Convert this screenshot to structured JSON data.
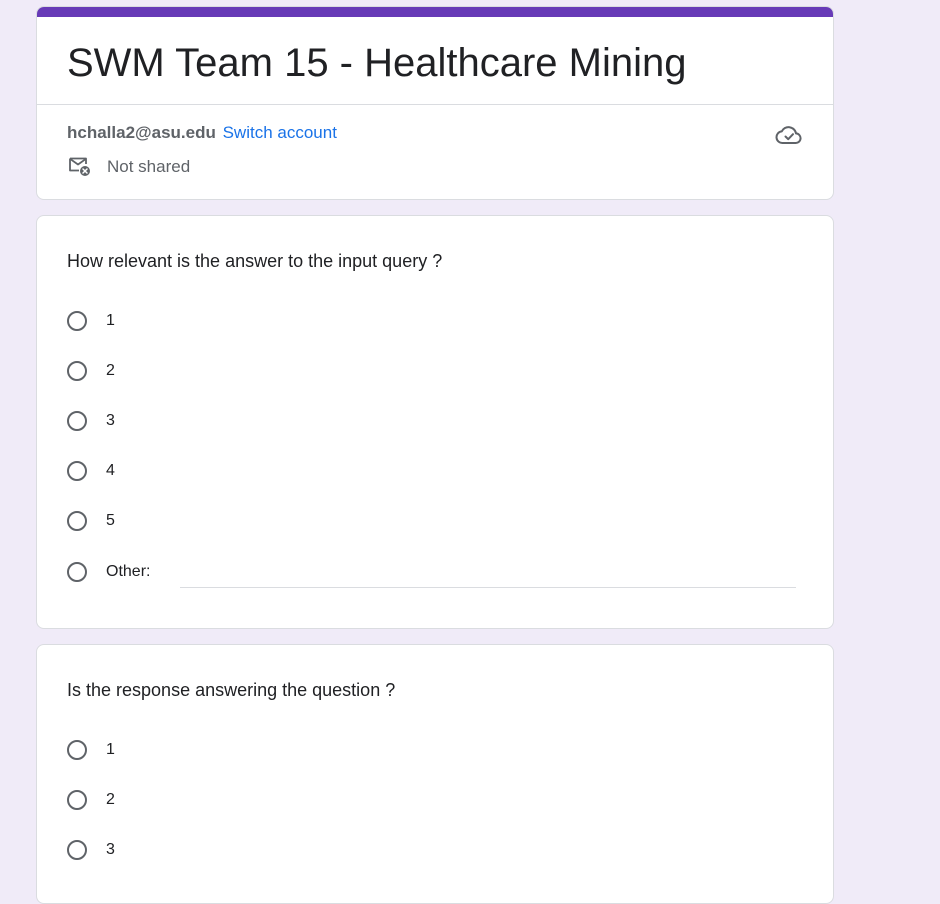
{
  "form": {
    "title": "SWM Team 15 - Healthcare Mining",
    "accent_color": "#673ab7",
    "background_color": "#f0ebf8"
  },
  "account": {
    "email": "hchalla2@asu.edu",
    "switch_label": "Switch account",
    "shared_status": "Not shared",
    "shared_icon": "mail-not-shared-icon",
    "sync_icon": "cloud-done-icon"
  },
  "questions": [
    {
      "title": "How relevant is the answer to the input query ?",
      "options": [
        "1",
        "2",
        "3",
        "4",
        "5",
        "Other:"
      ],
      "other_value": ""
    },
    {
      "title": "Is the response answering the question ?",
      "options": [
        "1",
        "2",
        "3"
      ]
    }
  ]
}
